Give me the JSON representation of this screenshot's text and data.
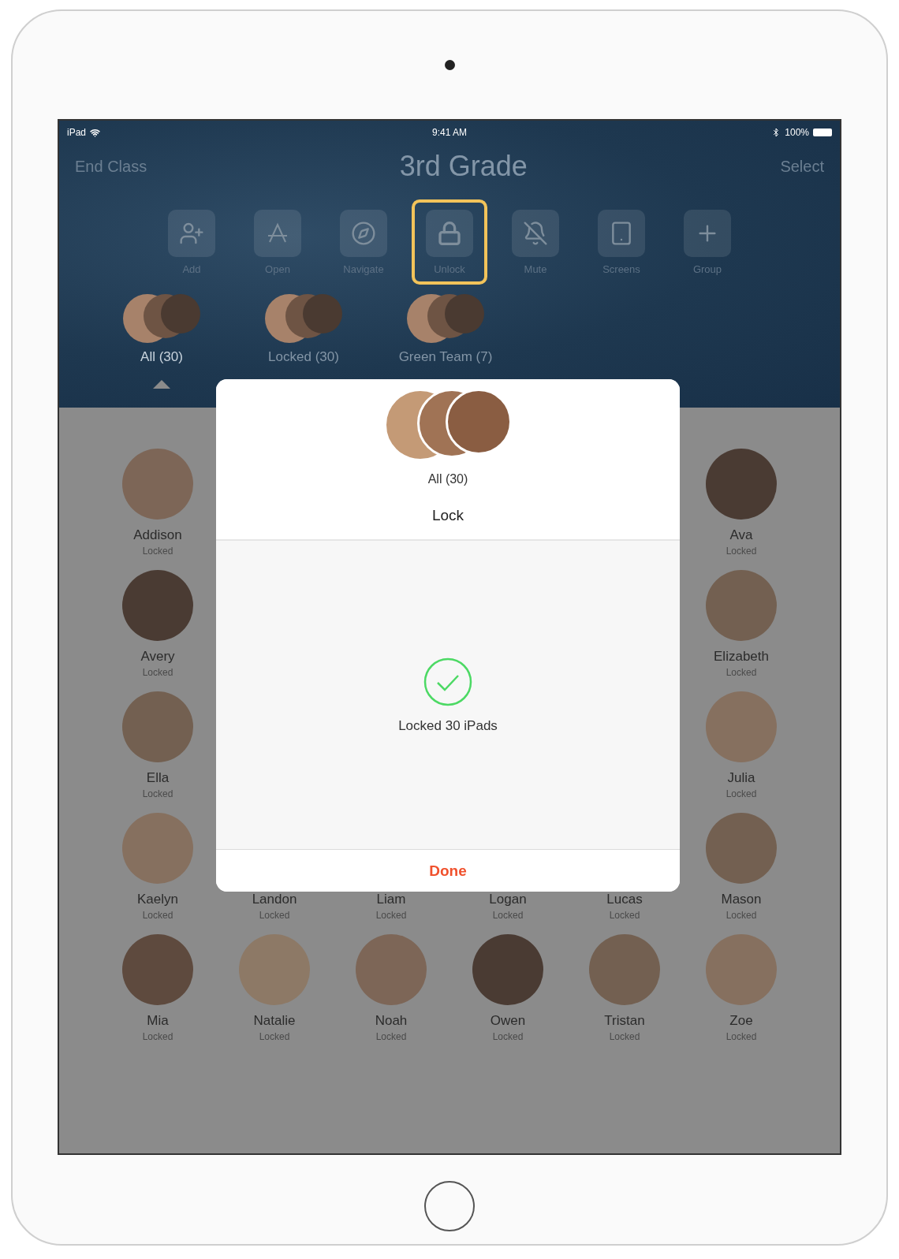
{
  "status_bar": {
    "carrier": "iPad",
    "time": "9:41 AM",
    "battery": "100%"
  },
  "nav": {
    "left": "End Class",
    "title": "3rd Grade",
    "right": "Select"
  },
  "toolbar": [
    {
      "kind": "add",
      "label": "Add",
      "selected": false
    },
    {
      "kind": "open",
      "label": "Open",
      "selected": false
    },
    {
      "kind": "navigate",
      "label": "Navigate",
      "selected": false
    },
    {
      "kind": "unlock",
      "label": "Unlock",
      "selected": true
    },
    {
      "kind": "mute",
      "label": "Mute",
      "selected": false
    },
    {
      "kind": "screens",
      "label": "Screens",
      "selected": false
    },
    {
      "kind": "group",
      "label": "Group",
      "selected": false
    }
  ],
  "groups": [
    {
      "label": "All (30)",
      "selected": true
    },
    {
      "label": "Locked (30)",
      "selected": false
    },
    {
      "label": "Green Team (7)",
      "selected": false
    }
  ],
  "students": [
    [
      {
        "name": "Addison",
        "status": "Locked"
      },
      {
        "name": "Ava",
        "status": "Locked"
      }
    ],
    [
      {
        "name": "Avery",
        "status": "Locked"
      },
      {
        "name": "Elizabeth",
        "status": "Locked"
      }
    ],
    [
      {
        "name": "Ella",
        "status": "Locked"
      },
      {
        "name": "Julia",
        "status": "Locked"
      }
    ],
    [
      {
        "name": "Kaelyn",
        "status": "Locked"
      },
      {
        "name": "Landon",
        "status": "Locked"
      },
      {
        "name": "Liam",
        "status": "Locked"
      },
      {
        "name": "Logan",
        "status": "Locked"
      },
      {
        "name": "Lucas",
        "status": "Locked"
      },
      {
        "name": "Mason",
        "status": "Locked"
      }
    ],
    [
      {
        "name": "Mia",
        "status": "Locked"
      },
      {
        "name": "Natalie",
        "status": "Locked"
      },
      {
        "name": "Noah",
        "status": "Locked"
      },
      {
        "name": "Owen",
        "status": "Locked"
      },
      {
        "name": "Tristan",
        "status": "Locked"
      },
      {
        "name": "Zoe",
        "status": "Locked"
      }
    ]
  ],
  "dialog": {
    "group": "All (30)",
    "action": "Lock",
    "result": "Locked 30 iPads",
    "button": "Done"
  }
}
